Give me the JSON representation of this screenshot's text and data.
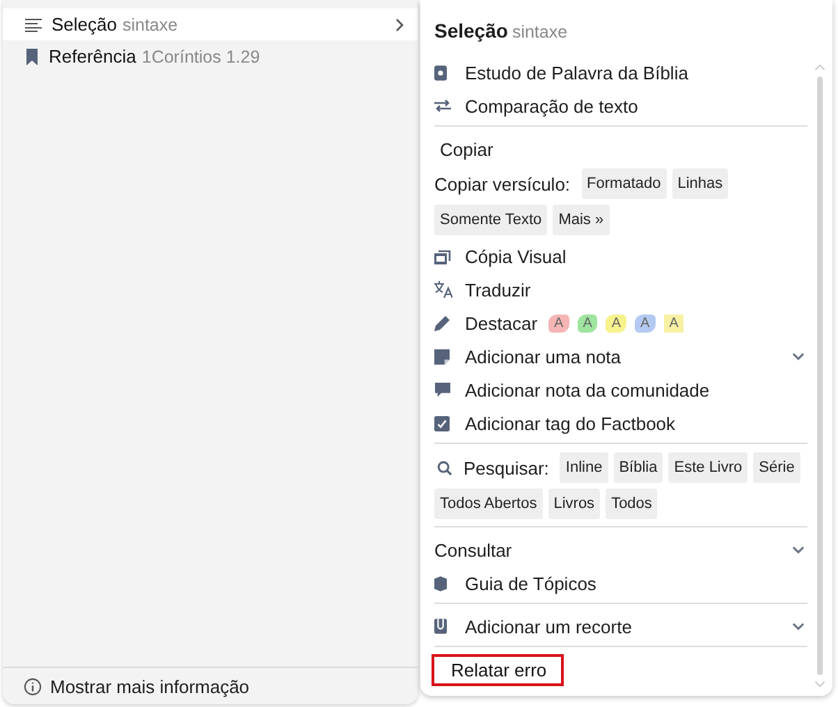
{
  "menu": {
    "items": [
      {
        "label": "Seleção",
        "detail": "sintaxe",
        "selected": true,
        "has_submenu": true
      },
      {
        "label": "Referência",
        "detail": "1Coríntios 1.29",
        "selected": false,
        "has_submenu": false
      }
    ],
    "footer": "Mostrar mais informação"
  },
  "panel": {
    "title": "Seleção",
    "subtitle": "sintaxe",
    "sections": [
      {
        "rows": [
          {
            "kind": "action",
            "label": "Estudo de Palavra da Bíblia",
            "expandable": false
          },
          {
            "kind": "action",
            "label": "Comparação de texto",
            "expandable": false
          }
        ]
      },
      {
        "rows": [
          {
            "kind": "plain",
            "label": "Copiar"
          },
          {
            "kind": "chips",
            "label": "Copiar versículo:",
            "chips": [
              "Formatado",
              "Linhas",
              "Somente Texto",
              "Mais »"
            ]
          },
          {
            "kind": "action",
            "label": "Cópia Visual",
            "expandable": false
          },
          {
            "kind": "action",
            "label": "Traduzir",
            "expandable": false
          },
          {
            "kind": "highlight",
            "label": "Destacar",
            "swatches": [
              {
                "text": "A",
                "color": "#f5b5b5"
              },
              {
                "text": "A",
                "color": "#9fe49f"
              },
              {
                "text": "A",
                "color": "#f6f28c"
              },
              {
                "text": "A",
                "color": "#b4c9f2"
              },
              {
                "text": "A",
                "color": "#f8f1a4"
              }
            ]
          },
          {
            "kind": "action",
            "label": "Adicionar uma nota",
            "expandable": true
          },
          {
            "kind": "action",
            "label": "Adicionar nota da comunidade",
            "expandable": false
          },
          {
            "kind": "action",
            "label": "Adicionar tag do Factbook",
            "expandable": false
          }
        ]
      },
      {
        "rows": [
          {
            "kind": "search",
            "label": "Pesquisar:",
            "chips": [
              "Inline",
              "Bíblia",
              "Este Livro",
              "Série",
              "Todos Abertos",
              "Livros",
              "Todos"
            ]
          }
        ]
      },
      {
        "rows": [
          {
            "kind": "header",
            "label": "Consultar",
            "expandable": true
          },
          {
            "kind": "action",
            "label": "Guia de Tópicos",
            "expandable": false
          }
        ]
      },
      {
        "rows": [
          {
            "kind": "action",
            "label": "Adicionar um recorte",
            "expandable": true
          }
        ]
      },
      {
        "rows": [
          {
            "kind": "report",
            "label": "Relatar erro"
          }
        ]
      }
    ]
  }
}
